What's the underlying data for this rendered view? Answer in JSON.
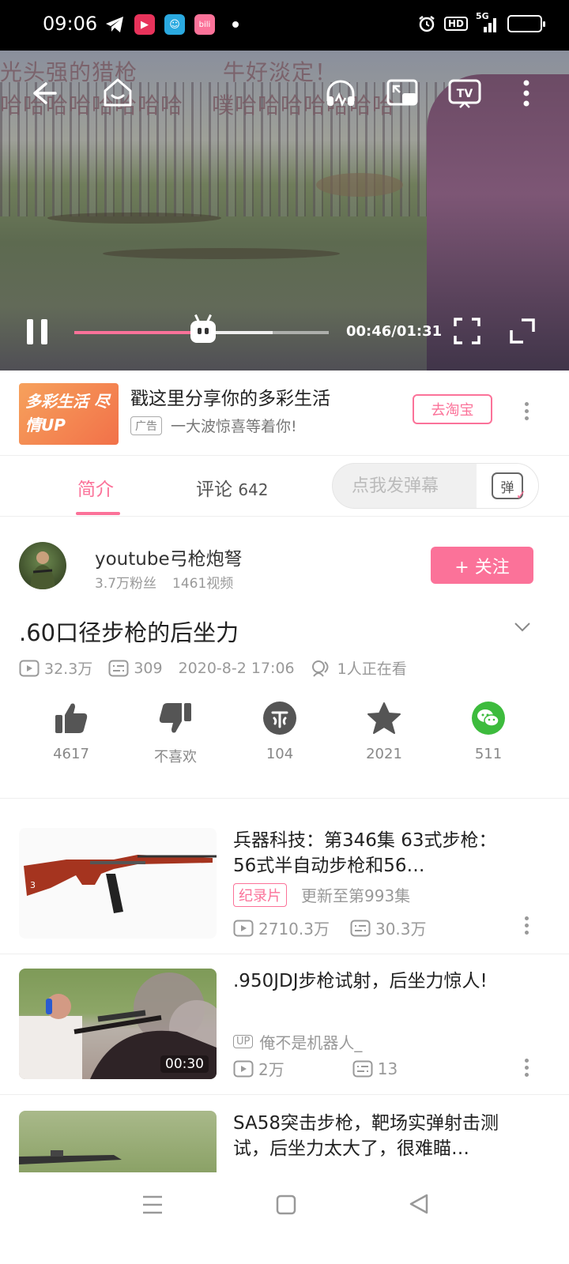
{
  "status_bar": {
    "time": "09:06",
    "app_icons": [
      {
        "name": "telegram-icon",
        "glyph": "➤",
        "color": "#000000"
      },
      {
        "name": "video-app-icon",
        "glyph": "▶",
        "color": "#e8335b"
      },
      {
        "name": "chat-app-icon",
        "glyph": "☺",
        "color": "#2aa9e0"
      },
      {
        "name": "bilibili-app-icon",
        "glyph": "bili",
        "color": "#fb7299"
      }
    ],
    "hd": "HD",
    "network": "5G"
  },
  "player": {
    "danmaku": [
      "光头强的猎枪",
      "牛好淡定！",
      "哈哈哈哈哈哈哈哈",
      "噗哈哈哈哈哈哈哈"
    ],
    "current_time": "00:46",
    "total_time": "01:31",
    "time_display": "00:46/01:31",
    "progress": 0.505
  },
  "ad": {
    "image_text": "多彩生活 尽情UP",
    "title": "戳这里分享你的多彩生活",
    "tag": "广告",
    "subtitle": "一大波惊喜等着你!",
    "button": "去淘宝"
  },
  "tabs": {
    "intro": "简介",
    "comments": "评论",
    "comment_count": "642",
    "danmaku_placeholder": "点我发弹幕",
    "danmaku_toggle": "弹"
  },
  "uploader": {
    "name": "youtube弓枪炮弩",
    "fans": "3.7万粉丝",
    "videos": "1461视频",
    "follow": "+ 关注"
  },
  "video": {
    "title": ".60口径步枪的后坐力",
    "views": "32.3万",
    "danmaku_count": "309",
    "date": "2020-8-2 17:06",
    "watching": "1人正在看"
  },
  "actions": {
    "like": "4617",
    "dislike": "不喜欢",
    "coin": "104",
    "favorite": "2021",
    "share": "511"
  },
  "related": [
    {
      "title": "兵器科技：第346集 63式步枪：56式半自动步枪和56…",
      "badge": "纪录片",
      "update": "更新至第993集",
      "views": "2710.3万",
      "danmaku": "30.3万"
    },
    {
      "title": ".950JDJ步枪试射，后坐力惊人!",
      "up_tag": "UP",
      "uploader": "俺不是机器人_",
      "views": "2万",
      "danmaku": "13",
      "duration": "00:30"
    },
    {
      "title": "SA58突击步枪，靶场实弹射击测试，后坐力太大了，很难瞄…"
    }
  ],
  "colors": {
    "accent": "#fb7299",
    "wechat": "#3dbb3d"
  }
}
